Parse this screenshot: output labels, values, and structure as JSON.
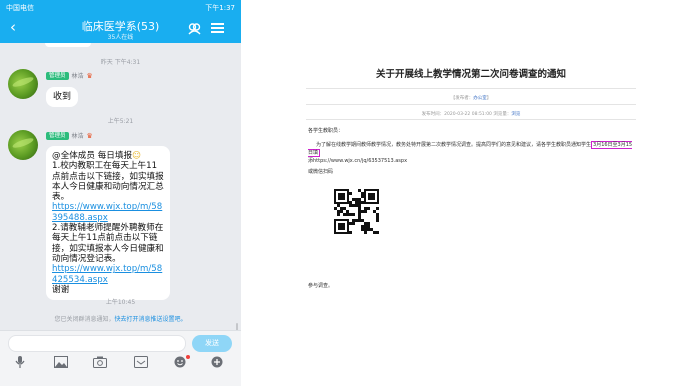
{
  "phone": {
    "status": {
      "left": "中国电信",
      "right": "下午1:37"
    },
    "title": "临床医学系(53)",
    "subtitle": "35人在线",
    "messages": [
      {
        "time": "昨天 下午4:31",
        "badge": "管理员",
        "sender": "林浩",
        "text": "收到"
      },
      {
        "time": "上午5:21",
        "badge": "管理员",
        "sender": "林浩",
        "lines": [
          "@全体成员  每日填报",
          "1.校内教职工在每天上午11点前点击以下链接，如实填报本人今日健康和动向情况汇总表。",
          "https://www.wjx.top/m/58395488.aspx",
          "2.请教辅老师提醒外聘教师在每天上午11点前点击以下链接，如实填报本人今日健康和动向情况登记表。",
          "https://www.wjx.top/m/58425534.aspx",
          "谢谢"
        ]
      }
    ],
    "time_last": "上午10:45",
    "system_msg": "您已关闭群消息通知，",
    "system_link": "快去打开消息推送设置吧。",
    "send_label": "发送",
    "toolbar_icons": [
      "mic-icon",
      "image-icon",
      "camera-icon",
      "picture-icon",
      "emoji-icon",
      "plus-icon"
    ]
  },
  "doc": {
    "title": "关于开展线上教学情况第二次问卷调查的通知",
    "meta1": "【发布者：",
    "meta1_link": "办公室",
    "meta1_end": "】",
    "meta2": "发布时间：2020-03-22 08:51:00  浏览量：",
    "meta2_link": "浏览",
    "greeting": "各学生教职员：",
    "para1": "为了解在线教学期间教师教学情况，教务处特开展第二次教学情况调查。提高同学们的意见和建议，请各学生教职员通知学生",
    "para1_highlight": "3月16日至3月15日填",
    "para2": "添https://www.wjx.cn/jq/63537513.aspx",
    "qr_label": "或微信扫码",
    "closing": "参与调查。",
    "colors": {
      "highlight_border": "#cc22cc",
      "link": "#3a6fc4"
    }
  }
}
